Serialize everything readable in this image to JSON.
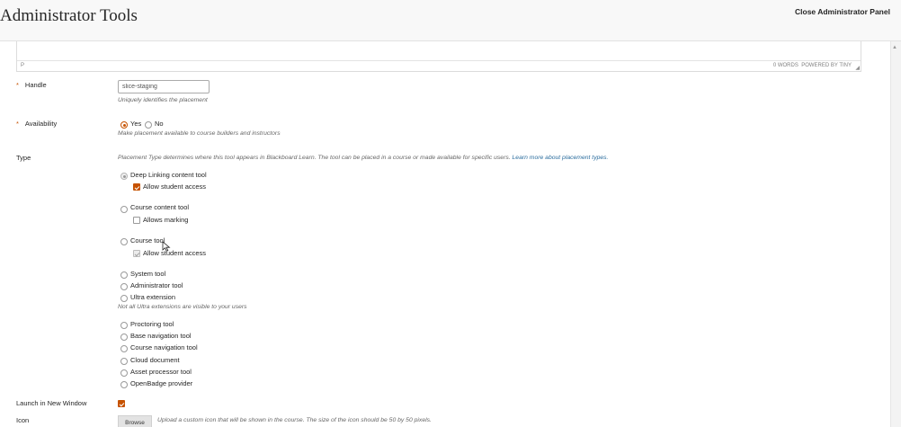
{
  "header": {
    "title": "Administrator Tools",
    "close_label": "Close Administrator Panel"
  },
  "editor": {
    "path": "P",
    "word_count": "0 WORDS",
    "powered_by": "POWERED BY TINY"
  },
  "handle": {
    "label": "Handle",
    "required_mark": "*",
    "value": "slice-staging",
    "help": "Uniquely identifies the placement"
  },
  "availability": {
    "label": "Availability",
    "required_mark": "*",
    "options": [
      "Yes",
      "No"
    ],
    "selected": "Yes",
    "help": "Make placement available to course builders and instructors"
  },
  "type": {
    "label": "Type",
    "help": "Placement Type determines where this tool appears in Blackboard Learn. The tool can be placed in a course or made available for specific users.",
    "help_link": "Learn more about placement types.",
    "selected": "Deep Linking content tool",
    "options": [
      {
        "label": "Deep Linking content tool",
        "checked": true,
        "sub": {
          "label": "Allow student access",
          "checked": true,
          "disabled": false
        }
      },
      {
        "label": "Course content tool",
        "checked": false,
        "sub": {
          "label": "Allows marking",
          "checked": false,
          "disabled": false
        }
      },
      {
        "label": "Course tool",
        "checked": false,
        "sub": {
          "label": "Allow student access",
          "checked": true,
          "disabled": true
        }
      },
      {
        "label": "System tool",
        "checked": false
      },
      {
        "label": "Administrator tool",
        "checked": false
      },
      {
        "label": "Ultra extension",
        "checked": false
      },
      {
        "label": "Proctoring tool",
        "checked": false
      },
      {
        "label": "Base navigation tool",
        "checked": false
      },
      {
        "label": "Course navigation tool",
        "checked": false
      },
      {
        "label": "Cloud document",
        "checked": false
      },
      {
        "label": "Asset processor tool",
        "checked": false
      },
      {
        "label": "OpenBadge provider",
        "checked": false
      }
    ],
    "ultra_note": "Not all Ultra extensions are visible to your users"
  },
  "launch": {
    "label": "Launch in New Window",
    "checked": true
  },
  "icon": {
    "label": "Icon",
    "browse_label": "Browse",
    "help": "Upload a custom icon that will be shown in the course. The size of the icon should be 50 by 50 pixels."
  },
  "colors": {
    "accent": "#c65200",
    "link": "#2b6d9e"
  }
}
